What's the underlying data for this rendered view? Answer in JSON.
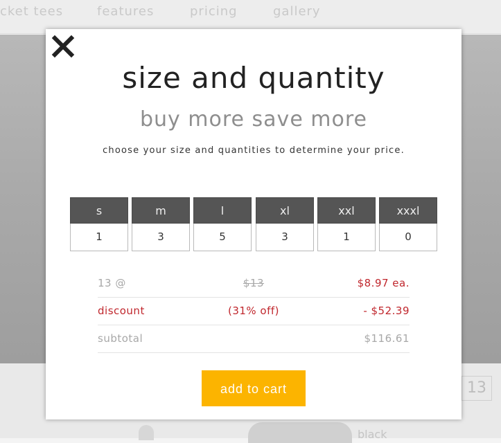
{
  "background": {
    "nav_items": [
      "cket tees",
      "features",
      "pricing",
      "gallery"
    ],
    "qty_box_value": "13",
    "color_label": "black"
  },
  "modal": {
    "close_icon": "close-x-icon",
    "title": "size and quantity",
    "subtitle": "buy more save more",
    "instructions": "choose your size and quantities to determine your price.",
    "sizes": [
      {
        "label": "s",
        "qty": "1"
      },
      {
        "label": "m",
        "qty": "3"
      },
      {
        "label": "l",
        "qty": "5"
      },
      {
        "label": "xl",
        "qty": "3"
      },
      {
        "label": "xxl",
        "qty": "1"
      },
      {
        "label": "xxxl",
        "qty": "0"
      }
    ],
    "pricing": {
      "qty_label": "13 @",
      "original_price": "$13",
      "unit_price": "$8.97 ea.",
      "discount_label": "discount",
      "discount_percent": "(31% off)",
      "discount_amount": "- $52.39",
      "subtotal_label": "subtotal",
      "subtotal_value": "$116.61"
    },
    "add_to_cart_label": "add to cart"
  },
  "colors": {
    "accent_button": "#fcb400",
    "discount_red": "#c0272d",
    "size_header": "#555555"
  }
}
